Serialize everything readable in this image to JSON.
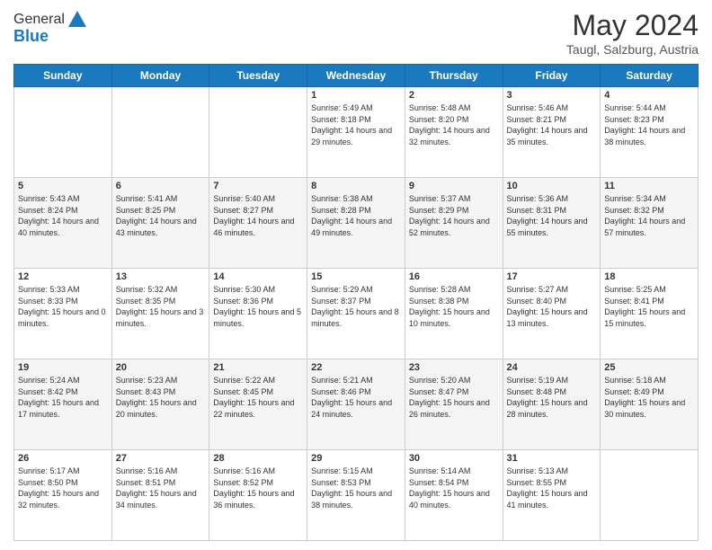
{
  "header": {
    "logo_general": "General",
    "logo_blue": "Blue",
    "month_title": "May 2024",
    "location": "Taugl, Salzburg, Austria"
  },
  "weekdays": [
    "Sunday",
    "Monday",
    "Tuesday",
    "Wednesday",
    "Thursday",
    "Friday",
    "Saturday"
  ],
  "weeks": [
    [
      {
        "day": "",
        "sunrise": "",
        "sunset": "",
        "daylight": ""
      },
      {
        "day": "",
        "sunrise": "",
        "sunset": "",
        "daylight": ""
      },
      {
        "day": "",
        "sunrise": "",
        "sunset": "",
        "daylight": ""
      },
      {
        "day": "1",
        "sunrise": "Sunrise: 5:49 AM",
        "sunset": "Sunset: 8:18 PM",
        "daylight": "Daylight: 14 hours and 29 minutes."
      },
      {
        "day": "2",
        "sunrise": "Sunrise: 5:48 AM",
        "sunset": "Sunset: 8:20 PM",
        "daylight": "Daylight: 14 hours and 32 minutes."
      },
      {
        "day": "3",
        "sunrise": "Sunrise: 5:46 AM",
        "sunset": "Sunset: 8:21 PM",
        "daylight": "Daylight: 14 hours and 35 minutes."
      },
      {
        "day": "4",
        "sunrise": "Sunrise: 5:44 AM",
        "sunset": "Sunset: 8:23 PM",
        "daylight": "Daylight: 14 hours and 38 minutes."
      }
    ],
    [
      {
        "day": "5",
        "sunrise": "Sunrise: 5:43 AM",
        "sunset": "Sunset: 8:24 PM",
        "daylight": "Daylight: 14 hours and 40 minutes."
      },
      {
        "day": "6",
        "sunrise": "Sunrise: 5:41 AM",
        "sunset": "Sunset: 8:25 PM",
        "daylight": "Daylight: 14 hours and 43 minutes."
      },
      {
        "day": "7",
        "sunrise": "Sunrise: 5:40 AM",
        "sunset": "Sunset: 8:27 PM",
        "daylight": "Daylight: 14 hours and 46 minutes."
      },
      {
        "day": "8",
        "sunrise": "Sunrise: 5:38 AM",
        "sunset": "Sunset: 8:28 PM",
        "daylight": "Daylight: 14 hours and 49 minutes."
      },
      {
        "day": "9",
        "sunrise": "Sunrise: 5:37 AM",
        "sunset": "Sunset: 8:29 PM",
        "daylight": "Daylight: 14 hours and 52 minutes."
      },
      {
        "day": "10",
        "sunrise": "Sunrise: 5:36 AM",
        "sunset": "Sunset: 8:31 PM",
        "daylight": "Daylight: 14 hours and 55 minutes."
      },
      {
        "day": "11",
        "sunrise": "Sunrise: 5:34 AM",
        "sunset": "Sunset: 8:32 PM",
        "daylight": "Daylight: 14 hours and 57 minutes."
      }
    ],
    [
      {
        "day": "12",
        "sunrise": "Sunrise: 5:33 AM",
        "sunset": "Sunset: 8:33 PM",
        "daylight": "Daylight: 15 hours and 0 minutes."
      },
      {
        "day": "13",
        "sunrise": "Sunrise: 5:32 AM",
        "sunset": "Sunset: 8:35 PM",
        "daylight": "Daylight: 15 hours and 3 minutes."
      },
      {
        "day": "14",
        "sunrise": "Sunrise: 5:30 AM",
        "sunset": "Sunset: 8:36 PM",
        "daylight": "Daylight: 15 hours and 5 minutes."
      },
      {
        "day": "15",
        "sunrise": "Sunrise: 5:29 AM",
        "sunset": "Sunset: 8:37 PM",
        "daylight": "Daylight: 15 hours and 8 minutes."
      },
      {
        "day": "16",
        "sunrise": "Sunrise: 5:28 AM",
        "sunset": "Sunset: 8:38 PM",
        "daylight": "Daylight: 15 hours and 10 minutes."
      },
      {
        "day": "17",
        "sunrise": "Sunrise: 5:27 AM",
        "sunset": "Sunset: 8:40 PM",
        "daylight": "Daylight: 15 hours and 13 minutes."
      },
      {
        "day": "18",
        "sunrise": "Sunrise: 5:25 AM",
        "sunset": "Sunset: 8:41 PM",
        "daylight": "Daylight: 15 hours and 15 minutes."
      }
    ],
    [
      {
        "day": "19",
        "sunrise": "Sunrise: 5:24 AM",
        "sunset": "Sunset: 8:42 PM",
        "daylight": "Daylight: 15 hours and 17 minutes."
      },
      {
        "day": "20",
        "sunrise": "Sunrise: 5:23 AM",
        "sunset": "Sunset: 8:43 PM",
        "daylight": "Daylight: 15 hours and 20 minutes."
      },
      {
        "day": "21",
        "sunrise": "Sunrise: 5:22 AM",
        "sunset": "Sunset: 8:45 PM",
        "daylight": "Daylight: 15 hours and 22 minutes."
      },
      {
        "day": "22",
        "sunrise": "Sunrise: 5:21 AM",
        "sunset": "Sunset: 8:46 PM",
        "daylight": "Daylight: 15 hours and 24 minutes."
      },
      {
        "day": "23",
        "sunrise": "Sunrise: 5:20 AM",
        "sunset": "Sunset: 8:47 PM",
        "daylight": "Daylight: 15 hours and 26 minutes."
      },
      {
        "day": "24",
        "sunrise": "Sunrise: 5:19 AM",
        "sunset": "Sunset: 8:48 PM",
        "daylight": "Daylight: 15 hours and 28 minutes."
      },
      {
        "day": "25",
        "sunrise": "Sunrise: 5:18 AM",
        "sunset": "Sunset: 8:49 PM",
        "daylight": "Daylight: 15 hours and 30 minutes."
      }
    ],
    [
      {
        "day": "26",
        "sunrise": "Sunrise: 5:17 AM",
        "sunset": "Sunset: 8:50 PM",
        "daylight": "Daylight: 15 hours and 32 minutes."
      },
      {
        "day": "27",
        "sunrise": "Sunrise: 5:16 AM",
        "sunset": "Sunset: 8:51 PM",
        "daylight": "Daylight: 15 hours and 34 minutes."
      },
      {
        "day": "28",
        "sunrise": "Sunrise: 5:16 AM",
        "sunset": "Sunset: 8:52 PM",
        "daylight": "Daylight: 15 hours and 36 minutes."
      },
      {
        "day": "29",
        "sunrise": "Sunrise: 5:15 AM",
        "sunset": "Sunset: 8:53 PM",
        "daylight": "Daylight: 15 hours and 38 minutes."
      },
      {
        "day": "30",
        "sunrise": "Sunrise: 5:14 AM",
        "sunset": "Sunset: 8:54 PM",
        "daylight": "Daylight: 15 hours and 40 minutes."
      },
      {
        "day": "31",
        "sunrise": "Sunrise: 5:13 AM",
        "sunset": "Sunset: 8:55 PM",
        "daylight": "Daylight: 15 hours and 41 minutes."
      },
      {
        "day": "",
        "sunrise": "",
        "sunset": "",
        "daylight": ""
      }
    ]
  ]
}
